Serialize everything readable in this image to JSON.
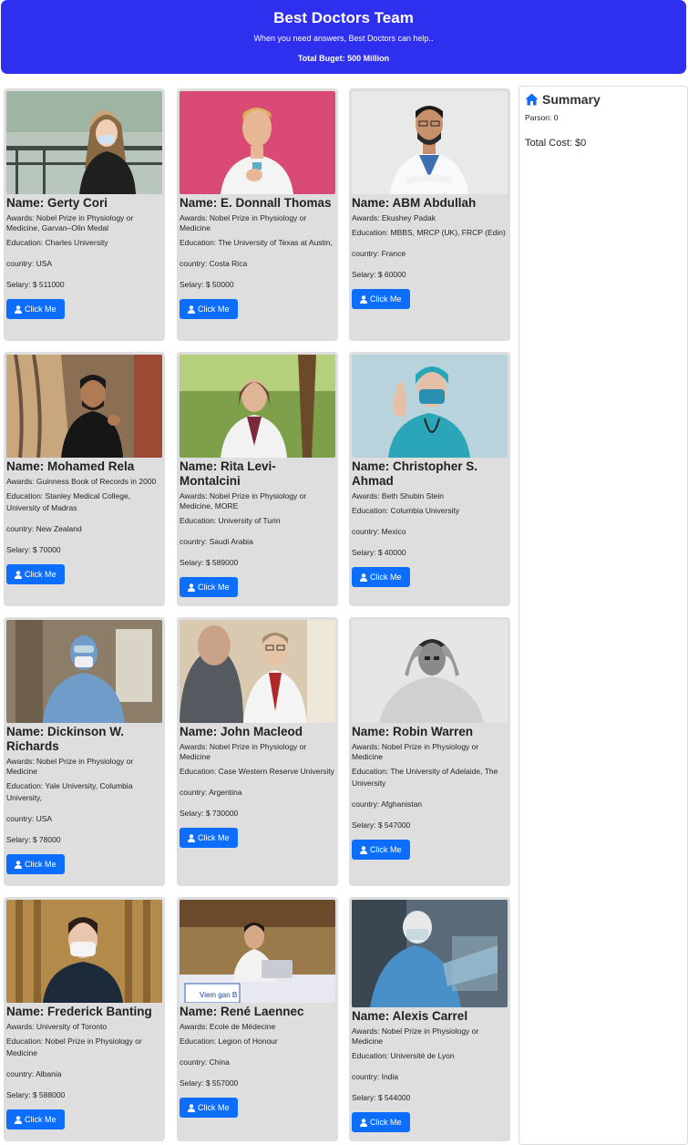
{
  "header": {
    "title": "Best Doctors Team",
    "subtitle": "When you need answers, Best Doctors can help..",
    "budget": "Total Buget: 500 Million"
  },
  "summary": {
    "heading": "Summary",
    "persons": "Parson: 0",
    "total": "Total Cost: $0"
  },
  "button_label": "Click Me",
  "doctors": [
    {
      "name": "Name: Gerty Cori",
      "awards": "Awards: Nobel Prize in Physiology or Medicine, Garvan–Olin Medal",
      "education": "Education: Charles University",
      "country": "country: USA",
      "salary": "Selary: $ 511000"
    },
    {
      "name": "Name: E. Donnall Thomas",
      "awards": "Awards: Nobel Prize in Physiology or Medicine",
      "education": "Education: The University of Texas at Austin,",
      "country": "country: Costa Rica",
      "salary": "Selary: $ 50000"
    },
    {
      "name": "Name: ABM Abdullah",
      "awards": "Awards: Ekushey Padak",
      "education": "Education: MBBS, MRCP (UK), FRCP (Edin)",
      "country": "country: France",
      "salary": "Selary: $ 60000"
    },
    {
      "name": "Name: Mohamed Rela",
      "awards": "Awards: Guinness Book of Records in 2000",
      "education": "Education: Stanley Medical College, University of Madras",
      "country": "country: New Zealand",
      "salary": "Selary: $ 70000"
    },
    {
      "name": "Name: Rita Levi-Montalcini",
      "awards": "Awards: Nobel Prize in Physiology or Medicine, MORE",
      "education": "Education: University of Turin",
      "country": "country: Saudi Arabia",
      "salary": "Selary: $ 589000"
    },
    {
      "name": "Name: Christopher S. Ahmad",
      "awards": "Awards: Beth Shubin Stein",
      "education": "Education: Columbia University",
      "country": "country: Mexico",
      "salary": "Selary: $ 40000"
    },
    {
      "name": "Name: Dickinson W. Richards",
      "awards": "Awards: Nobel Prize in Physiology or Medicine",
      "education": "Education: Yale University, Columbia University,",
      "country": "country: USA",
      "salary": "Selary: $ 78000"
    },
    {
      "name": "Name: John Macleod",
      "awards": "Awards: Nobel Prize in Physiology or Medicine",
      "education": "Education: Case Western Reserve University",
      "country": "country: Argentina",
      "salary": "Selary: $ 730000"
    },
    {
      "name": "Name: Robin Warren",
      "awards": "Awards: Nobel Prize in Physiology or Medicine",
      "education": "Education: The University of Adelaide, The University",
      "country": "country: Afghanistan",
      "salary": "Selary: $ 547000"
    },
    {
      "name": "Name: Frederick Banting",
      "awards": "Awards: University of Toronto",
      "education": "Education: Nobel Prize in Physiology or Medicine",
      "country": "country: Albania",
      "salary": "Selary: $ 588000"
    },
    {
      "name": "Name: René Laennec",
      "awards": "Awards: Ecole de Médecine",
      "education": "Education: Legion of Honour",
      "country": "country: China",
      "salary": "Selary: $ 557000"
    },
    {
      "name": "Name: Alexis Carrel",
      "awards": "Awards: Nobel Prize in Physiology or Medicine",
      "education": "Education: Université de Lyon",
      "country": "country: India",
      "salary": "Selary: $ 544000"
    }
  ],
  "photo_label": "Viem gan B",
  "colors": {
    "header": "#2f2ff0",
    "button": "#0d6efd",
    "card": "#dedede"
  }
}
